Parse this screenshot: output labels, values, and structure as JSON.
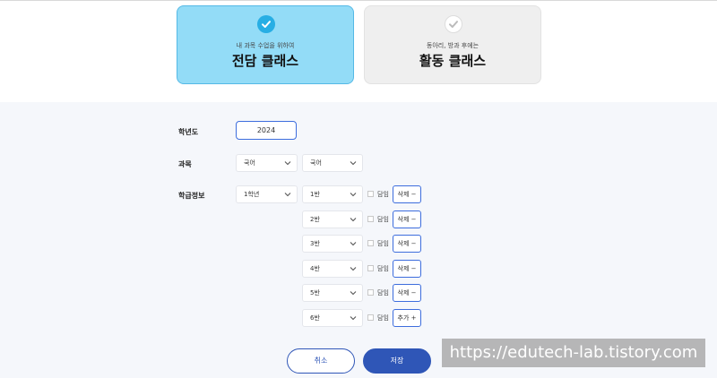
{
  "cards": [
    {
      "subtitle": "내 과목 수업을 위하여",
      "title": "전담 클래스",
      "selected": true
    },
    {
      "subtitle": "동아리, 방과 후에는",
      "title": "활동 클래스",
      "selected": false
    }
  ],
  "form": {
    "year_label": "학년도",
    "year_value": "2024",
    "subject_label": "과목",
    "subject_values": [
      "국어",
      "국어"
    ],
    "class_info_label": "학급정보",
    "grade_value": "1학년",
    "classes": [
      {
        "value": "1반",
        "check_label": "담임",
        "action": "삭제 −"
      },
      {
        "value": "2반",
        "check_label": "담임",
        "action": "삭제 −"
      },
      {
        "value": "3반",
        "check_label": "담임",
        "action": "삭제 −"
      },
      {
        "value": "4반",
        "check_label": "담임",
        "action": "삭제 −"
      },
      {
        "value": "5반",
        "check_label": "담임",
        "action": "삭제 −"
      },
      {
        "value": "6반",
        "check_label": "담임",
        "action": "추가 +"
      }
    ]
  },
  "buttons": {
    "cancel": "취소",
    "save": "저장"
  },
  "watermark": "https://edutech-lab.tistory.com",
  "colors": {
    "accent": "#2f56b7",
    "active_card": "#93dcf7",
    "check": "#27aee4"
  }
}
